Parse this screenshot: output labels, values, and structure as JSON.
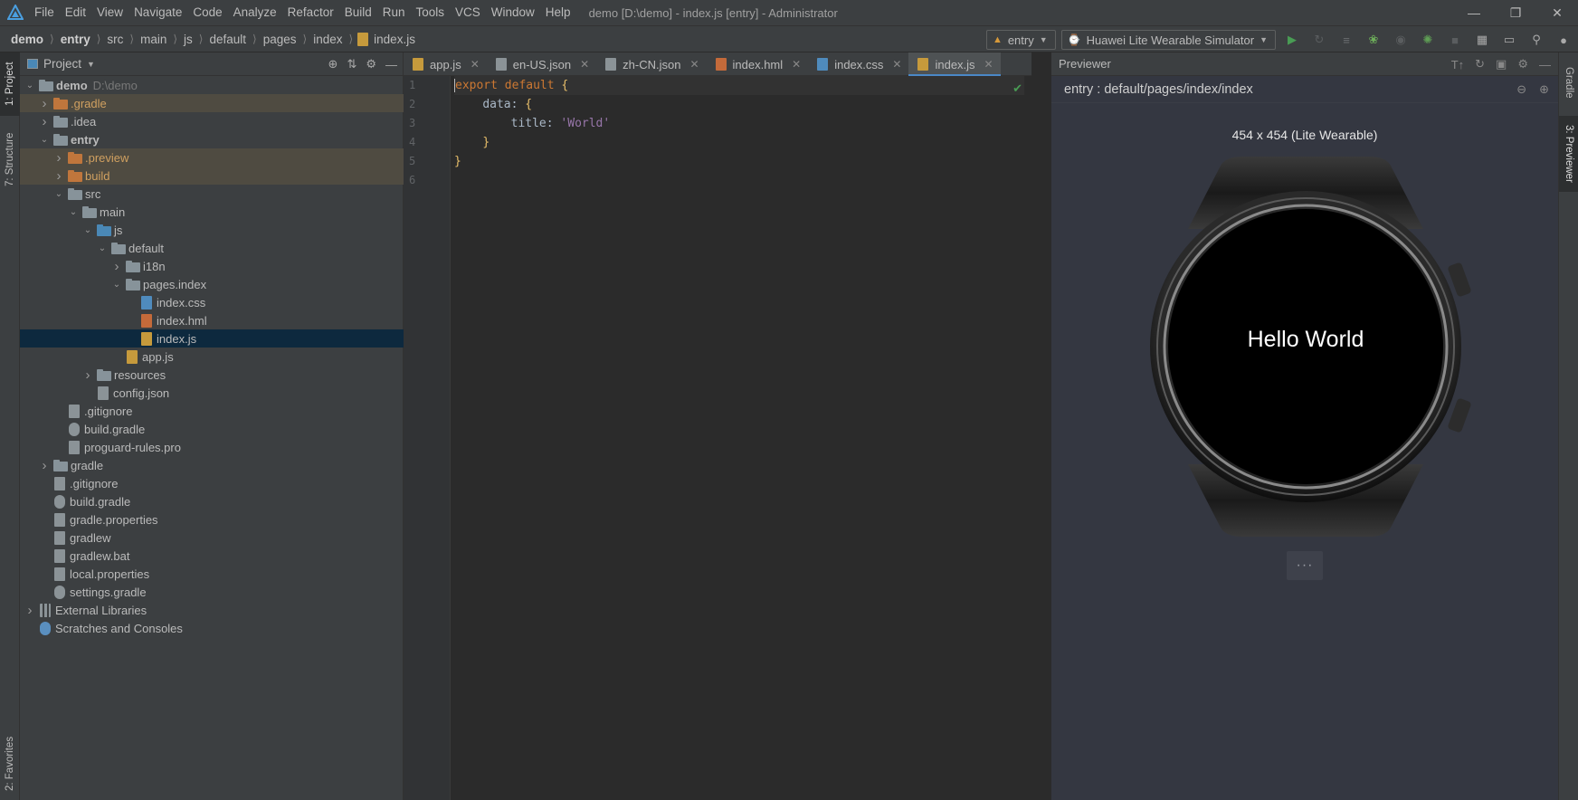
{
  "menubar": {
    "items": [
      "File",
      "Edit",
      "View",
      "Navigate",
      "Code",
      "Analyze",
      "Refactor",
      "Build",
      "Run",
      "Tools",
      "VCS",
      "Window",
      "Help"
    ],
    "window_title": "demo [D:\\demo] - index.js [entry] - Administrator"
  },
  "breadcrumb": [
    "demo",
    "entry",
    "src",
    "main",
    "js",
    "default",
    "pages",
    "index",
    "index.js"
  ],
  "toolbar": {
    "module_combo": "entry",
    "device_combo": "Huawei Lite Wearable Simulator"
  },
  "left_tabs": {
    "project": "1: Project",
    "structure": "7: Structure",
    "favorites": "2: Favorites"
  },
  "right_tabs": {
    "gradle": "Gradle",
    "previewer": "3: Previewer"
  },
  "project_panel": {
    "title": "Project",
    "tree": [
      {
        "label": "demo",
        "extra": "D:\\demo",
        "level": 0,
        "type": "folder",
        "expanded": true,
        "bold": true
      },
      {
        "label": ".gradle",
        "level": 1,
        "type": "folder-orange",
        "expanded": false,
        "excluded": true
      },
      {
        "label": ".idea",
        "level": 1,
        "type": "folder",
        "expanded": false
      },
      {
        "label": "entry",
        "level": 1,
        "type": "folder",
        "expanded": true,
        "bold": true
      },
      {
        "label": ".preview",
        "level": 2,
        "type": "folder-orange",
        "expanded": false,
        "excluded": true
      },
      {
        "label": "build",
        "level": 2,
        "type": "folder-orange",
        "expanded": false,
        "excluded": true
      },
      {
        "label": "src",
        "level": 2,
        "type": "folder",
        "expanded": true
      },
      {
        "label": "main",
        "level": 3,
        "type": "folder",
        "expanded": true
      },
      {
        "label": "js",
        "level": 4,
        "type": "folder-blue",
        "expanded": true
      },
      {
        "label": "default",
        "level": 5,
        "type": "folder",
        "expanded": true
      },
      {
        "label": "i18n",
        "level": 6,
        "type": "folder",
        "expanded": false
      },
      {
        "label": "pages.index",
        "level": 6,
        "type": "folder",
        "expanded": true
      },
      {
        "label": "index.css",
        "level": 7,
        "type": "file-css"
      },
      {
        "label": "index.hml",
        "level": 7,
        "type": "file-hml"
      },
      {
        "label": "index.js",
        "level": 7,
        "type": "file-js",
        "selected": true
      },
      {
        "label": "app.js",
        "level": 6,
        "type": "file-js"
      },
      {
        "label": "resources",
        "level": 4,
        "type": "folder",
        "expanded": false
      },
      {
        "label": "config.json",
        "level": 4,
        "type": "file-gray"
      },
      {
        "label": ".gitignore",
        "level": 2,
        "type": "file-gray"
      },
      {
        "label": "build.gradle",
        "level": 2,
        "type": "file-gradle"
      },
      {
        "label": "proguard-rules.pro",
        "level": 2,
        "type": "file-gray"
      },
      {
        "label": "gradle",
        "level": 1,
        "type": "folder",
        "expanded": false
      },
      {
        "label": ".gitignore",
        "level": 1,
        "type": "file-gray"
      },
      {
        "label": "build.gradle",
        "level": 1,
        "type": "file-gradle"
      },
      {
        "label": "gradle.properties",
        "level": 1,
        "type": "file-gray"
      },
      {
        "label": "gradlew",
        "level": 1,
        "type": "file-gray"
      },
      {
        "label": "gradlew.bat",
        "level": 1,
        "type": "file-gray"
      },
      {
        "label": "local.properties",
        "level": 1,
        "type": "file-gray"
      },
      {
        "label": "settings.gradle",
        "level": 1,
        "type": "file-gradle"
      },
      {
        "label": "External Libraries",
        "level": 0,
        "type": "libs",
        "expanded": false
      },
      {
        "label": "Scratches and Consoles",
        "level": 0,
        "type": "scratch"
      }
    ]
  },
  "editor": {
    "tabs": [
      {
        "label": "app.js",
        "icon": "js"
      },
      {
        "label": "en-US.json",
        "icon": "json"
      },
      {
        "label": "zh-CN.json",
        "icon": "json"
      },
      {
        "label": "index.hml",
        "icon": "hml"
      },
      {
        "label": "index.css",
        "icon": "css"
      },
      {
        "label": "index.js",
        "icon": "js",
        "active": true
      }
    ],
    "line_numbers": [
      "1",
      "2",
      "3",
      "4",
      "5",
      "6"
    ],
    "code": {
      "l1_kw": "export default",
      "l1_brace": "{",
      "l2_key": "data",
      "l2_brace": "{",
      "l3_key": "title",
      "l3_val": "'World'",
      "l4_brace": "}",
      "l5_brace": "}"
    }
  },
  "previewer": {
    "title": "Previewer",
    "path": "entry : default/pages/index/index",
    "device_label": "454 x 454 (Lite Wearable)",
    "screen_text": "Hello World",
    "more_label": "···"
  },
  "colors": {
    "accent": "#4a88c7",
    "selection": "#0d293e",
    "excluded": "#4f4b41",
    "success": "#499c54"
  }
}
